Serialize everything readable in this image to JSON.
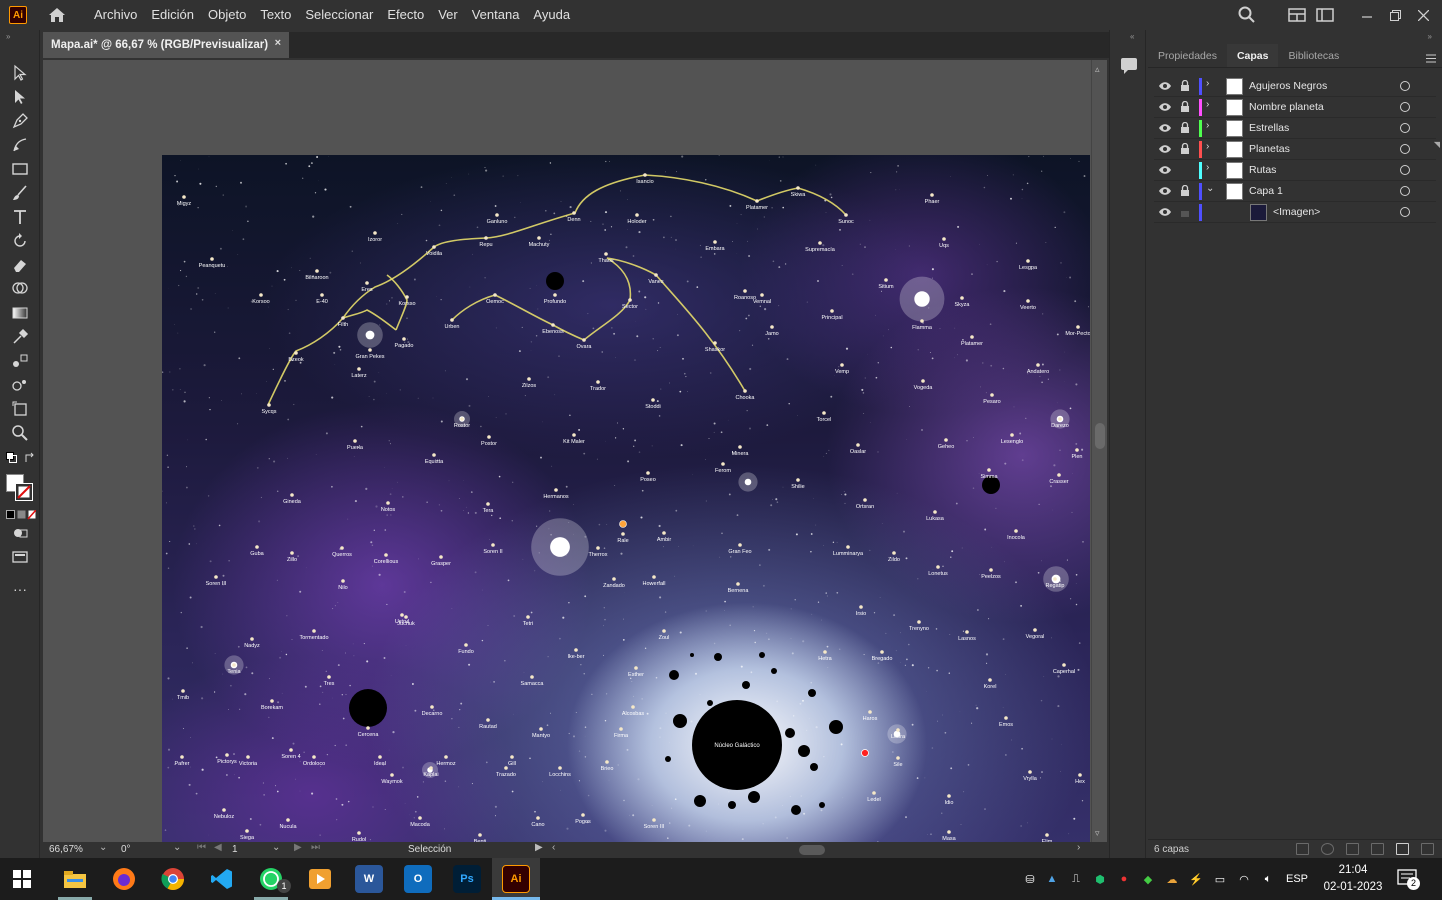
{
  "app": {
    "logo": "Ai",
    "menus": [
      "Archivo",
      "Edición",
      "Objeto",
      "Texto",
      "Seleccionar",
      "Efecto",
      "Ver",
      "Ventana",
      "Ayuda"
    ]
  },
  "document": {
    "tab_title": "Mapa.ai* @ 66,67 % (RGB/Previsualizar)",
    "close": "×"
  },
  "statusbar": {
    "zoom": "66,67%",
    "rotation": "0°",
    "artboard": "1",
    "tool": "Selección"
  },
  "panel": {
    "tabs": [
      "Propiedades",
      "Capas",
      "Bibliotecas"
    ],
    "active_tab": "Capas",
    "layers": [
      {
        "name": "Agujeros Negros",
        "color": "#4f4fff",
        "locked": true,
        "expanded": false
      },
      {
        "name": "Nombre planeta",
        "color": "#ff4fff",
        "locked": true,
        "expanded": false
      },
      {
        "name": "Estrellas",
        "color": "#4fff4f",
        "locked": true,
        "expanded": false
      },
      {
        "name": "Planetas",
        "color": "#ff4f4f",
        "locked": true,
        "expanded": false
      },
      {
        "name": "Rutas",
        "color": "#4fffff",
        "locked": false,
        "expanded": false
      },
      {
        "name": "Capa 1",
        "color": "#4f4fff",
        "locked": true,
        "expanded": true
      },
      {
        "name": "<Imagen>",
        "color": "#4f4fff",
        "locked": false,
        "sublayer": true
      }
    ],
    "layer_count": "6 capas"
  },
  "map": {
    "core_label": "Núcleo Galáctico",
    "planets": [
      "Migyz",
      "Ganluno",
      "Isancio",
      "Platamer",
      "Skiwa",
      "Sunoc",
      "Phaer",
      "Izoror",
      "Denn",
      "Holoder",
      "Peanquetu",
      "Voidila",
      "Repu",
      "Machuty",
      "Embara",
      "Supremacía",
      "Uqs",
      "Lesgpa",
      "Bilnaroon",
      "E-40",
      "Korsoo",
      "Eres",
      "Korsso",
      "Thaos",
      "Profundo",
      "Vanes",
      "Sitium",
      "Skyza",
      "Vemnal",
      "Oemoc",
      "Sector",
      "Roanoso",
      "Principal",
      "Flamma",
      "Veerto",
      "Mor-Pecto",
      "Filth",
      "Urben",
      "Ebenoss",
      "Jamo",
      "Platamer",
      "Gran Pekes",
      "Pagado",
      "Ovara",
      "Shaskor",
      "Bzeok",
      "Laterz",
      "Zilzos",
      "Trador",
      "Vemp",
      "Andatero",
      "Sycqs",
      "Chooka",
      "Vogeda",
      "Pesaro",
      "Stoddi",
      "Rostor",
      "Torcel",
      "Darezo",
      "Kit Maler",
      "Postor",
      "Puerla",
      "Equista",
      "Minera",
      "Oaslar",
      "Geheo",
      "Lesenglo",
      "Ferom",
      "Poseo",
      "Plen",
      "Shilie",
      "Hermanos",
      "Crasser",
      "Gineda",
      "Notos",
      "Ortsran",
      "Simma",
      "Tera",
      "Rale",
      "Ambir",
      "Lukasa",
      "Inocola",
      "Querros",
      "Guba",
      "Zillo",
      "Soren II",
      "Therrox",
      "Gran Feo",
      "Regatip",
      "Lumminarya",
      "Corellious",
      "Grasper",
      "Zildo",
      "Lonetus",
      "Peelzos",
      "Soren III",
      "Nilo",
      "Zandado",
      "Howerfall",
      "Bernena",
      "Juchuk",
      "Tetri",
      "Ustrul",
      "Irsio",
      "Trenyno",
      "Nadyz",
      "Tormentado",
      "Fundo",
      "Zoul",
      "Lasnos",
      "Vegoral",
      "Ike-ber",
      "Hetra",
      "Bregado",
      "Caperhal",
      "Tenia",
      "Tres",
      "Samacca",
      "Esther",
      "Korel",
      "Tmib",
      "Borekam",
      "Decarno",
      "Alcosbas",
      "Haros",
      "Emos",
      "Cercena",
      "Rautad",
      "Mantyo",
      "Firma",
      "Lobra",
      "Pictorys",
      "Soren 4",
      "Kaplai",
      "Trazado",
      "Locchins",
      "Brieo",
      "Sile",
      "Vrylla",
      "Waymok",
      "Ledel",
      "Idio",
      "Nebuloz",
      "Nucula",
      "Macoda",
      "Cano",
      "Pogos",
      "Soren III",
      "Siega",
      "Rudol",
      "Benti",
      "Masa",
      "Elim",
      "Hex",
      "Pafrer",
      "Victoria",
      "Ordoloco",
      "Ideal",
      "Hermoz",
      "Gill"
    ]
  },
  "taskbar": {
    "lang": "ESP",
    "time": "21:04",
    "date": "02-01-2023",
    "notif_count": "2",
    "whatsapp_badge": "1"
  },
  "colors": {
    "route": "#e6dc6a",
    "accent": "#ff9a00",
    "taskbar_underline": "#76b9ed"
  }
}
